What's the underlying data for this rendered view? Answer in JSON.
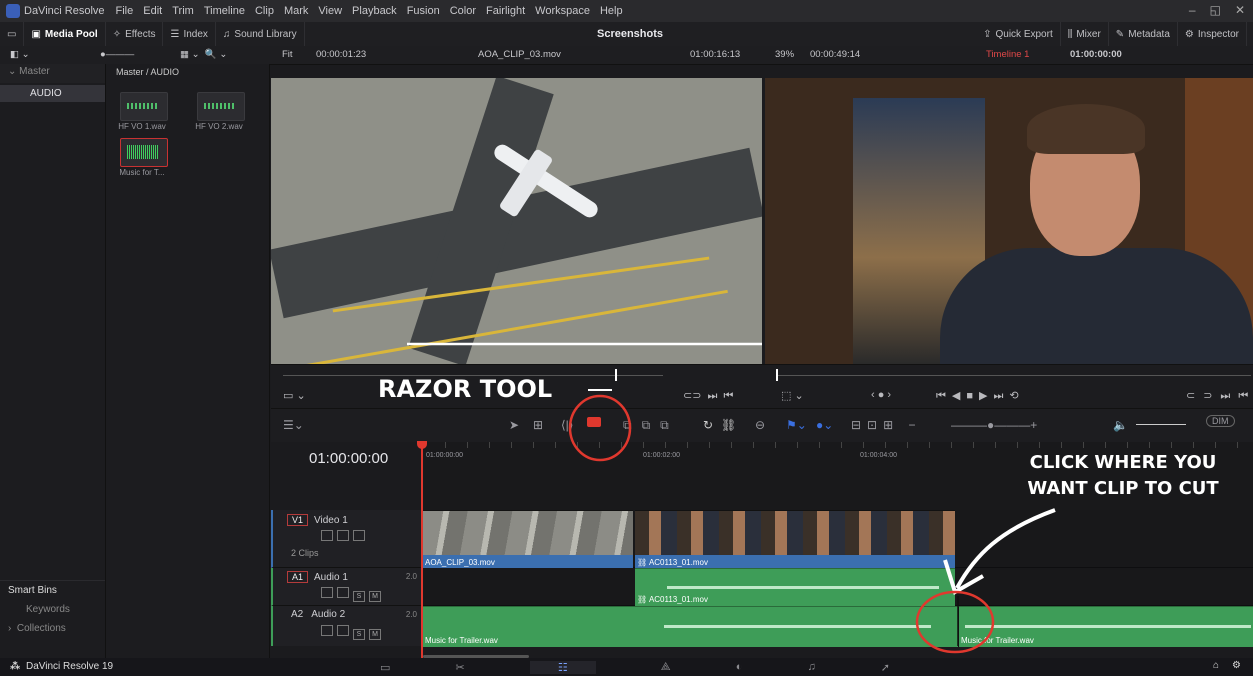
{
  "menubar": {
    "app_name": "DaVinci Resolve",
    "items": [
      "File",
      "Edit",
      "Trim",
      "Timeline",
      "Clip",
      "Mark",
      "View",
      "Playback",
      "Fusion",
      "Color",
      "Fairlight",
      "Workspace",
      "Help"
    ]
  },
  "toolbar": {
    "media_pool": "Media Pool",
    "effects": "Effects",
    "index": "Index",
    "sound_library": "Sound Library",
    "project_title": "Screenshots",
    "quick_export": "Quick Export",
    "mixer": "Mixer",
    "metadata": "Metadata",
    "inspector": "Inspector"
  },
  "viewer_bar": {
    "fit": "Fit",
    "source_tc": "00:00:01:23",
    "source_clip": "AOA_CLIP_03.mov",
    "source_pos": "01:00:16:13",
    "zoom": "39%",
    "timeline_tc": "00:00:49:14",
    "timeline_name": "Timeline 1",
    "record_tc": "01:00:00:00"
  },
  "bins": {
    "master": "Master",
    "audio": "AUDIO",
    "path": "Master / AUDIO",
    "smart_bins": "Smart Bins",
    "keywords": "Keywords",
    "collections": "Collections"
  },
  "clips": [
    "HF VO 1.wav",
    "HF VO 2.wav",
    "Music for T..."
  ],
  "timeline": {
    "timecode": "01:00:00:00",
    "ruler": [
      "01:00:00:00",
      "01:00:02:00",
      "01:00:04:00"
    ],
    "dim": "DIM"
  },
  "tracks": {
    "v1_tag": "V1",
    "v1_name": "Video 1",
    "v1_count": "2 Clips",
    "a1_tag": "A1",
    "a1_name": "Audio 1",
    "a1_ch": "2.0",
    "a2_tag": "A2",
    "a2_name": "Audio 2",
    "a2_ch": "2.0",
    "clip_aoa": "AOA_CLIP_03.mov",
    "clip_ac": "AC0113_01.mov",
    "clip_music": "Music for Trailer.wav"
  },
  "annotations": {
    "razor": "RAZOR TOOL",
    "click1": "CLICK WHERE YOU",
    "click2": "WANT CLIP TO CUT"
  },
  "footer": {
    "app": "DaVinci Resolve 19"
  },
  "colors": {
    "accent_red": "#e0382e",
    "video_clip": "#3b6fb0",
    "audio_clip": "#3e9d58"
  }
}
